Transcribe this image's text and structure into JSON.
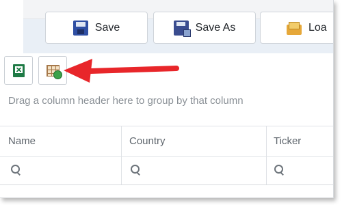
{
  "toolbar": {
    "save_label": "Save",
    "save_as_label": "Save As",
    "load_label": "Loa"
  },
  "icons": {
    "save": "save-icon",
    "save_as": "save-as-icon",
    "load": "folder-open-icon",
    "export": "excel-export-icon",
    "grid": "grid-settings-icon",
    "arrow": "red-arrow"
  },
  "grid": {
    "group_hint": "Drag a column header here to group by that column",
    "columns": [
      "Name",
      "Country",
      "Ticker"
    ]
  },
  "colors": {
    "toolbar_bg": "#e9eff6",
    "arrow": "#e8262a",
    "text_muted": "#8a9096"
  }
}
